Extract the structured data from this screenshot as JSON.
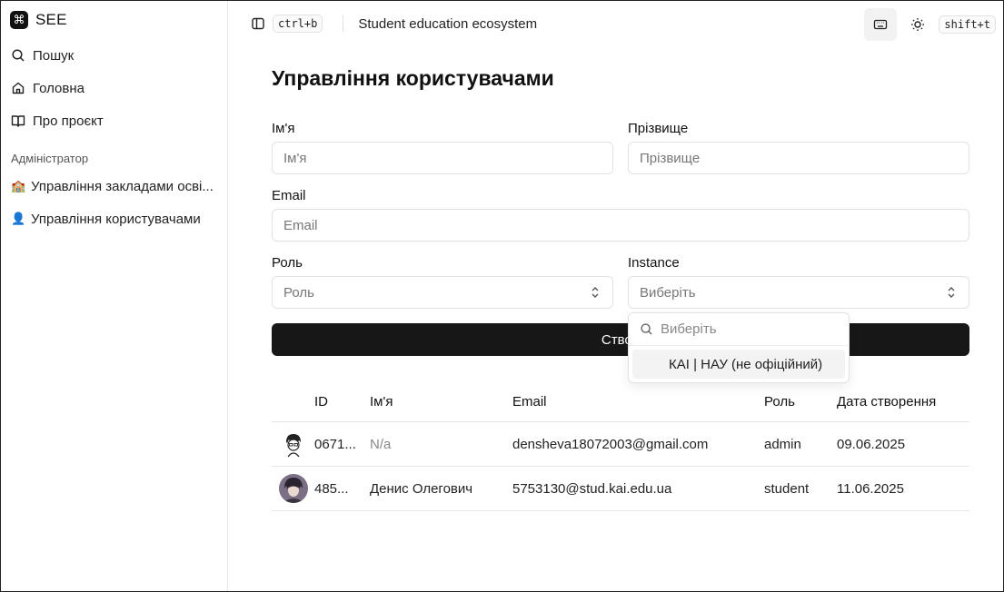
{
  "brand": {
    "logo_glyph": "⌘",
    "name": "SEE"
  },
  "sidebar": {
    "items": [
      {
        "label": "Пошук",
        "icon": "search-icon"
      },
      {
        "label": "Головна",
        "icon": "home-icon"
      },
      {
        "label": "Про проєкт",
        "icon": "book-icon"
      }
    ],
    "section_label": "Адміністратор",
    "admin_items": [
      {
        "label": "Управління закладами осві...",
        "emoji": "🏫"
      },
      {
        "label": "Управління користувачами",
        "emoji": "👤"
      }
    ]
  },
  "header": {
    "sidebar_shortcut": "ctrl+b",
    "title": "Student education ecosystem",
    "theme_shortcut": "shift+t"
  },
  "main": {
    "page_title": "Управління користувачами",
    "form": {
      "first_name_label": "Ім'я",
      "first_name_placeholder": "Ім'я",
      "last_name_label": "Прізвище",
      "last_name_placeholder": "Прізвище",
      "email_label": "Email",
      "email_placeholder": "Email",
      "role_label": "Роль",
      "role_placeholder": "Роль",
      "instance_label": "Instance",
      "instance_placeholder": "Виберіть",
      "submit_label": "Створ"
    },
    "dropdown": {
      "search_placeholder": "Виберіть",
      "options": [
        "КАІ | НАУ (не офіційний)"
      ]
    },
    "table": {
      "columns": [
        "ID",
        "Ім'я",
        "Email",
        "Роль",
        "Дата створення"
      ],
      "rows": [
        {
          "id": "0671...",
          "name": "N/a",
          "email": "densheva18072003@gmail.com",
          "role": "admin",
          "created": "09.06.2025"
        },
        {
          "id": "485...",
          "name": "Денис Олегович",
          "email": "5753130@stud.kai.edu.ua",
          "role": "student",
          "created": "11.06.2025"
        }
      ]
    }
  },
  "colors": {
    "primary_button": "#171717",
    "border": "#e2e2e2",
    "muted_text": "#777777"
  }
}
